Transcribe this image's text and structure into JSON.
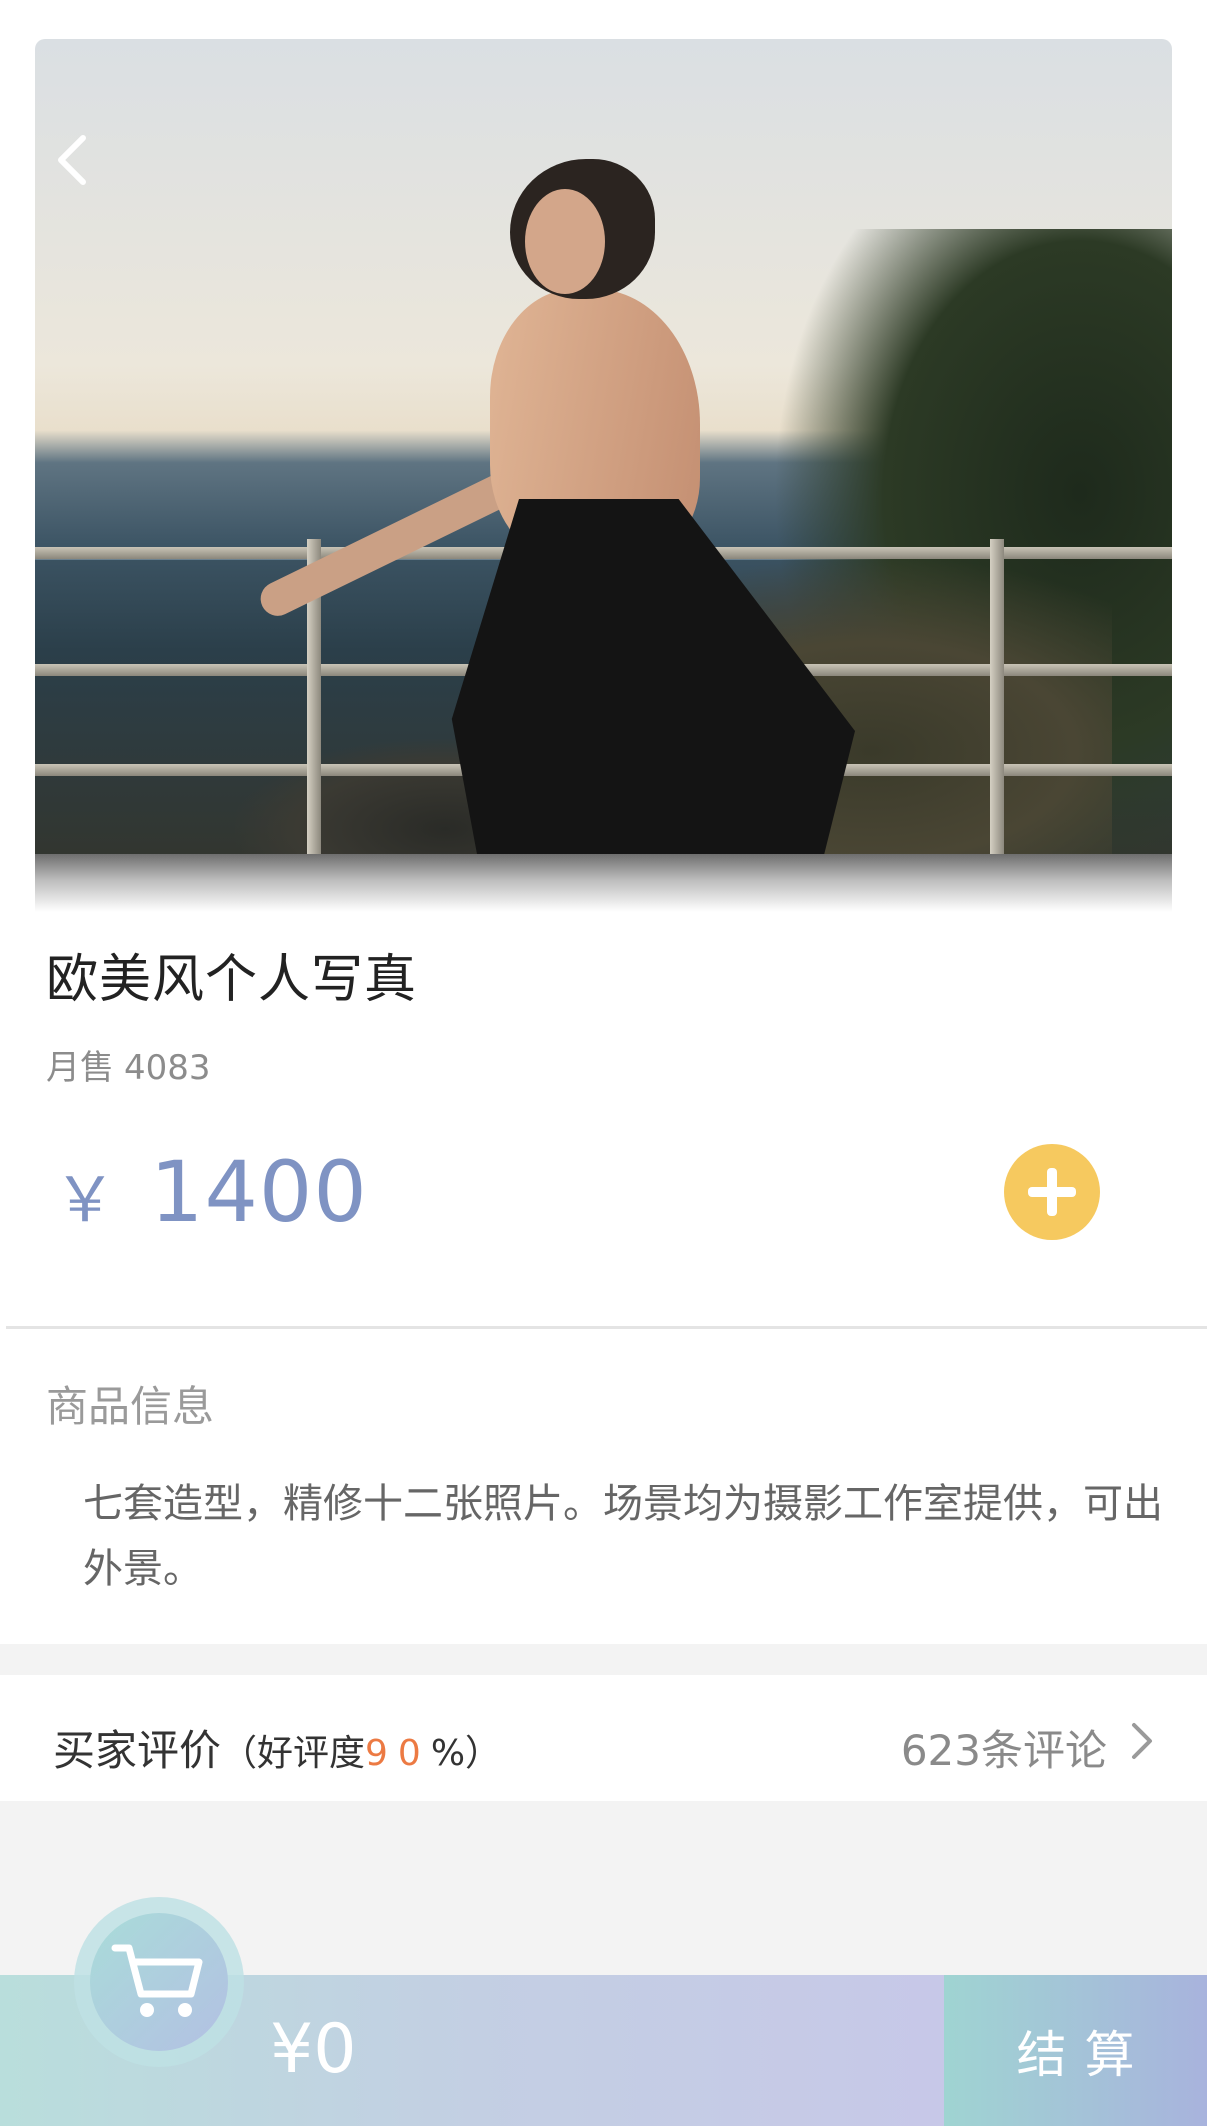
{
  "product": {
    "title": "欧美风个人写真",
    "sales_label": "月售",
    "sales_count": "4083",
    "currency_symbol": "￥",
    "price": "1400"
  },
  "info": {
    "section_label": "商品信息",
    "description": "七套造型，精修十二张照片。场景均为摄影工作室提供，可出外景。"
  },
  "reviews": {
    "label": "买家评价",
    "rating_prefix": "（好评度",
    "rating_value": "90",
    "rating_suffix": "%）",
    "count_text": "623条评论"
  },
  "cart": {
    "total": "¥0",
    "checkout_label": "结算"
  },
  "colors": {
    "price": "#7f93c3",
    "add_button": "#f6c95f",
    "rating_highlight": "#ec7a43"
  },
  "icons": {
    "back": "chevron-left-icon",
    "add": "plus-icon",
    "reviews_arrow": "chevron-right-icon",
    "cart": "shopping-cart-icon"
  }
}
